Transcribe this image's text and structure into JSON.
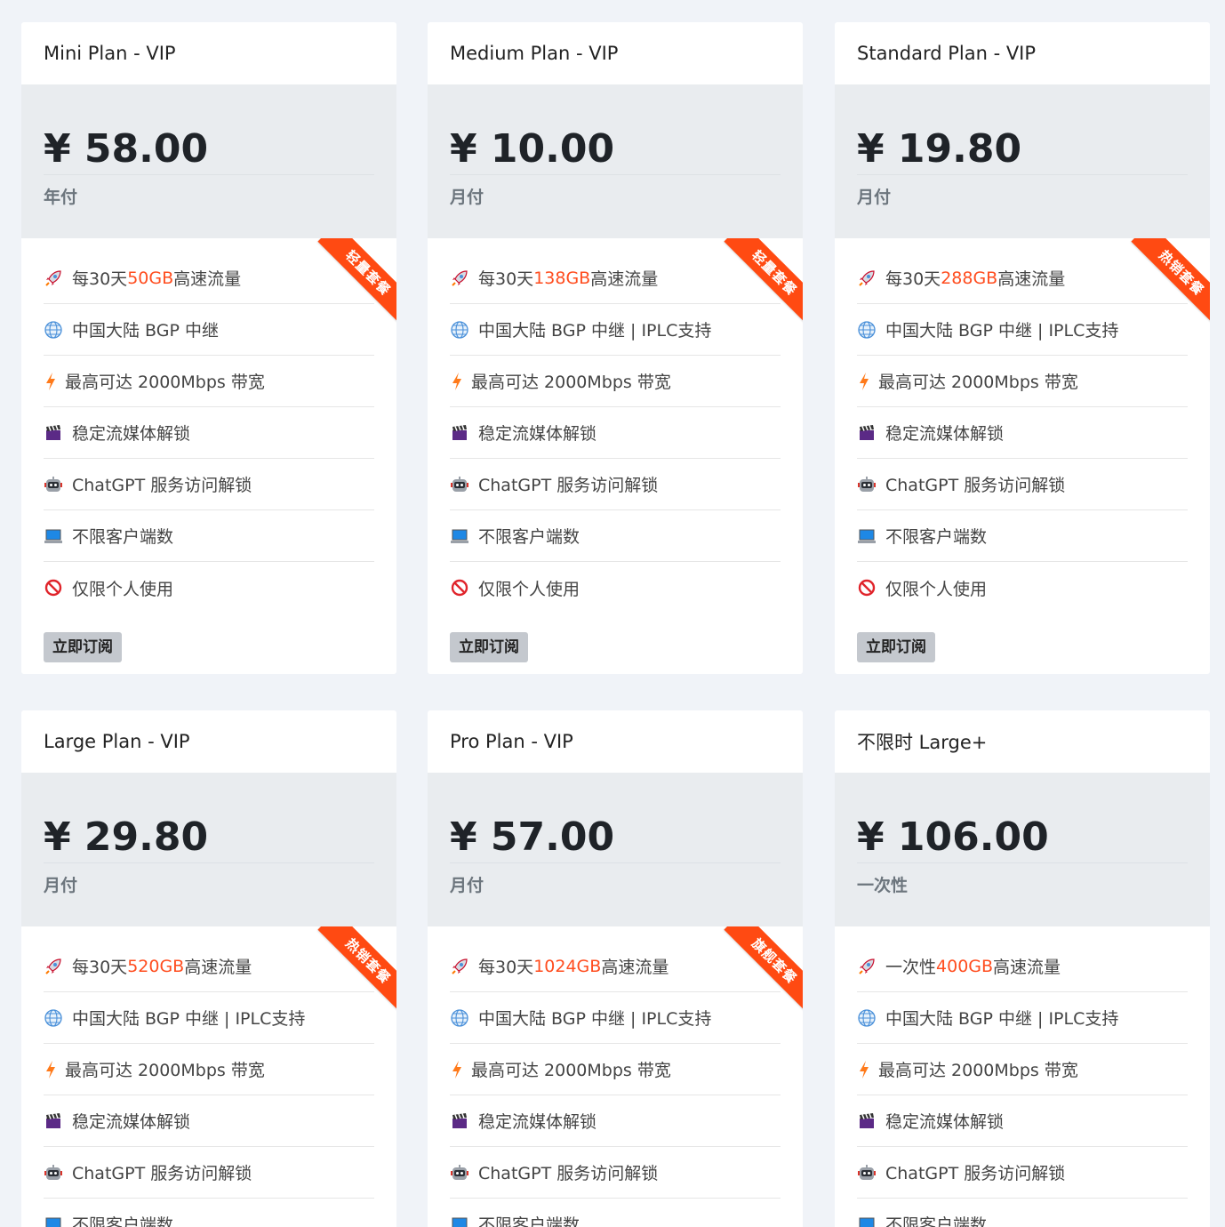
{
  "currency_symbol": "¥",
  "accent_color": "#ff4d1f",
  "subscribe_label": "立即订阅",
  "plans": [
    {
      "name": "Mini Plan - VIP",
      "price": "¥ 58.00",
      "period": "年付",
      "ribbon": "轻量套餐",
      "traffic_prefix": "每30天",
      "traffic_amount": "50GB",
      "traffic_suffix": "高速流量",
      "relay": "中国大陆 BGP 中继",
      "bandwidth": "最高可达 2000Mbps 带宽",
      "streaming": "稳定流媒体解锁",
      "chatgpt": "ChatGPT 服务访问解锁",
      "clients": "不限客户端数",
      "personal": "仅限个人使用"
    },
    {
      "name": "Medium Plan - VIP",
      "price": "¥ 10.00",
      "period": "月付",
      "ribbon": "轻量套餐",
      "traffic_prefix": "每30天",
      "traffic_amount": "138GB",
      "traffic_suffix": "高速流量",
      "relay": "中国大陆 BGP 中继 | IPLC支持",
      "bandwidth": "最高可达 2000Mbps 带宽",
      "streaming": "稳定流媒体解锁",
      "chatgpt": "ChatGPT 服务访问解锁",
      "clients": "不限客户端数",
      "personal": "仅限个人使用"
    },
    {
      "name": "Standard Plan - VIP",
      "price": "¥ 19.80",
      "period": "月付",
      "ribbon": "热销套餐",
      "traffic_prefix": "每30天",
      "traffic_amount": "288GB",
      "traffic_suffix": "高速流量",
      "relay": "中国大陆 BGP 中继 | IPLC支持",
      "bandwidth": "最高可达 2000Mbps 带宽",
      "streaming": "稳定流媒体解锁",
      "chatgpt": "ChatGPT 服务访问解锁",
      "clients": "不限客户端数",
      "personal": "仅限个人使用"
    },
    {
      "name": "Large Plan - VIP",
      "price": "¥ 29.80",
      "period": "月付",
      "ribbon": "热销套餐",
      "traffic_prefix": "每30天",
      "traffic_amount": "520GB",
      "traffic_suffix": "高速流量",
      "relay": "中国大陆 BGP 中继 | IPLC支持",
      "bandwidth": "最高可达 2000Mbps 带宽",
      "streaming": "稳定流媒体解锁",
      "chatgpt": "ChatGPT 服务访问解锁",
      "clients": "不限客户端数"
    },
    {
      "name": "Pro Plan - VIP",
      "price": "¥ 57.00",
      "period": "月付",
      "ribbon": "旗舰套餐",
      "traffic_prefix": "每30天",
      "traffic_amount": "1024GB",
      "traffic_suffix": "高速流量",
      "relay": "中国大陆 BGP 中继 | IPLC支持",
      "bandwidth": "最高可达 2000Mbps 带宽",
      "streaming": "稳定流媒体解锁",
      "chatgpt": "ChatGPT 服务访问解锁",
      "clients": "不限客户端数"
    },
    {
      "name": "不限时 Large+",
      "price": "¥ 106.00",
      "period": "一次性",
      "ribbon": "",
      "traffic_prefix": "一次性",
      "traffic_amount": "400GB",
      "traffic_suffix": "高速流量",
      "relay": "中国大陆 BGP 中继 | IPLC支持",
      "bandwidth": "最高可达 2000Mbps 带宽",
      "streaming": "稳定流媒体解锁",
      "chatgpt": "ChatGPT 服务访问解锁",
      "clients": "不限客户端数"
    }
  ]
}
